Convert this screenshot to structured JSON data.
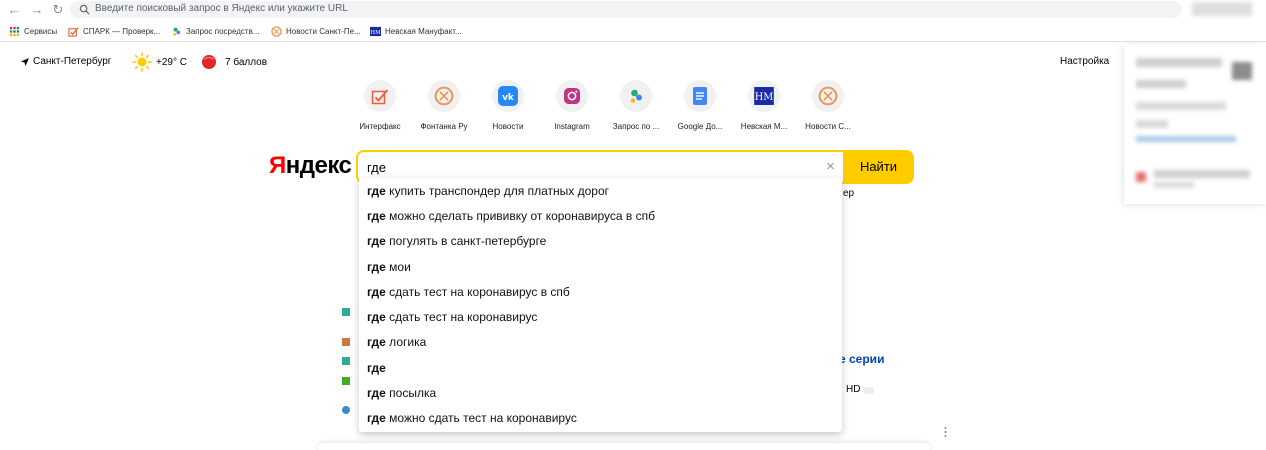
{
  "browser": {
    "url_placeholder": "Введите поисковый запрос в Яндекс или укажите URL",
    "bookmarks": [
      {
        "label": "Сервисы",
        "icon": "apps-grid-icon"
      },
      {
        "label": "СПАРК — Проверк...",
        "icon": "spark-checkmark-icon"
      },
      {
        "label": "Запрос посредств...",
        "icon": "leaf-icon"
      },
      {
        "label": "Новости Санкт-Пе...",
        "icon": "fontanka-icon"
      },
      {
        "label": "Невская Мануфакт...",
        "icon": "nm-logo-icon"
      }
    ]
  },
  "header": {
    "city": "Санкт-Петербург",
    "weather": "+29° С",
    "traffic": "7 баллов",
    "settings": "Настройка"
  },
  "tiles": [
    {
      "label": "Интерфакс",
      "icon": "interfax-icon"
    },
    {
      "label": "Фонтанка Ру",
      "icon": "fontanka-icon"
    },
    {
      "label": "Новости",
      "icon": "vk-icon"
    },
    {
      "label": "Instagram",
      "icon": "instagram-icon"
    },
    {
      "label": "Запрос по ...",
      "icon": "leaf-icon"
    },
    {
      "label": "Google До...",
      "icon": "google-docs-icon"
    },
    {
      "label": "Невская М...",
      "icon": "nm-logo-icon"
    },
    {
      "label": "Новости С...",
      "icon": "fontanka-icon"
    }
  ],
  "logo": {
    "first": "Я",
    "rest": "ндекс"
  },
  "search": {
    "value": "где",
    "clear": "×",
    "button": "Найти",
    "suggestions": [
      {
        "bold": "где",
        "rest": " купить транспондер для платных дорог"
      },
      {
        "bold": "где",
        "rest": " можно сделать прививку от коронавируса в спб"
      },
      {
        "bold": "где",
        "rest": " погулять в санкт-петербурге"
      },
      {
        "bold": "где",
        "rest": " мои"
      },
      {
        "bold": "где",
        "rest": " сдать тест на коронавирус в спб"
      },
      {
        "bold": "где",
        "rest": " сдать тест на коронавирус"
      },
      {
        "bold": "где",
        "rest": " логика"
      },
      {
        "bold": "где",
        "rest": ""
      },
      {
        "bold": "где",
        "rest": " посылка"
      },
      {
        "bold": "где",
        "rest": " можно сдать тест на коронавирус"
      }
    ]
  },
  "background_fragments": {
    "frag_er": "ер",
    "frag_series": "е серии",
    "frag_hd": "HD"
  },
  "colors": {
    "accent_yellow": "#ffcc00",
    "logo_red": "#ff0000",
    "link_blue": "#04b"
  }
}
